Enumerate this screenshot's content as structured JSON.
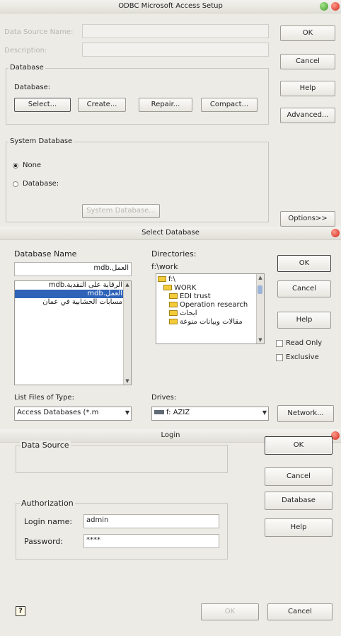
{
  "odbc": {
    "title": "ODBC Microsoft Access Setup",
    "dsn_label": "Data Source Name:",
    "desc_label": "Description:",
    "database_group": "Database",
    "database_label": "Database:",
    "select": "Select...",
    "create": "Create...",
    "repair": "Repair...",
    "compact": "Compact...",
    "sysdb_group": "System Database",
    "none": "None",
    "database_radio": "Database:",
    "sysdb_button": "System Database...",
    "ok": "OK",
    "cancel": "Cancel",
    "help": "Help",
    "advanced": "Advanced...",
    "options": "Options>>"
  },
  "selectdb": {
    "title": "Select Database",
    "dbname_label": "Database Name",
    "dbname_value": "العمل.mdb",
    "files": [
      "الرقابة على النقدية.mdb",
      "العمل.mdb",
      "مسابات الحشابية في عمان"
    ],
    "selected_file_index": 1,
    "dirs_label": "Directories:",
    "dir_path": "f:\\work",
    "dirs": [
      "f:\\",
      "WORK",
      "EDI trust",
      "Operation research",
      "ابحاث",
      "مقالات وبيانات منوعة"
    ],
    "listtype_label": "List Files of Type:",
    "listtype_value": "Access Databases (*.m",
    "drives_label": "Drives:",
    "drive_value": "f: AZIZ",
    "ok": "OK",
    "cancel": "Cancel",
    "help": "Help",
    "readonly": "Read Only",
    "exclusive": "Exclusive",
    "network": "Network..."
  },
  "login": {
    "title": "Login",
    "ds_group": "Data Source",
    "auth_group": "Authorization",
    "login_label": "Login name:",
    "login_value": "admin",
    "password_label": "Password:",
    "password_value": "****",
    "ok": "OK",
    "cancel": "Cancel",
    "database": "Database",
    "help": "Help",
    "footer_ok": "OK",
    "footer_cancel": "Cancel"
  }
}
